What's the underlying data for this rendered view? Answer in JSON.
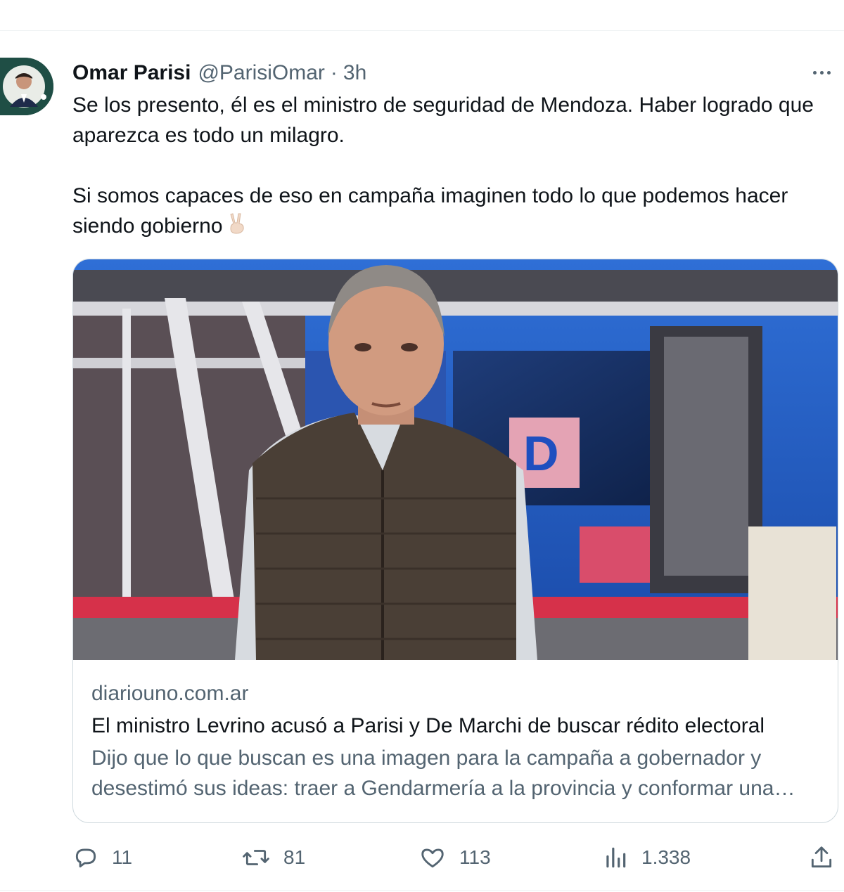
{
  "tweet": {
    "author_name": "Omar Parisi",
    "author_handle": "@ParisiOmar",
    "separator": "·",
    "time": "3h",
    "paragraph_1": "Se los presento, él es el ministro de seguridad de Mendoza. Haber logrado que aparezca es todo un milagro.",
    "paragraph_2": "Si somos capaces de eso en campaña imaginen todo lo que podemos hacer siendo gobierno",
    "emoji": "victory-hand-emoji"
  },
  "card": {
    "domain": "diariouno.com.ar",
    "title": "El ministro Levrino acusó a Parisi y De Marchi de buscar rédito electoral",
    "description": "Dijo que lo que buscan es una imagen para la campaña a gobernador y desestimó sus ideas: traer a Gendarmería a la provincia y conformar una policía",
    "image_icon": "news-photo-man-in-tv-studio"
  },
  "actions": {
    "replies": "11",
    "reposts": "81",
    "likes": "113",
    "views": "1.338"
  },
  "icons": {
    "reply": "reply-icon",
    "repost": "repost-icon",
    "like": "heart-icon",
    "views": "views-icon",
    "share": "share-icon",
    "more": "more-icon"
  },
  "colors": {
    "text_primary": "#0f1419",
    "text_secondary": "#536471",
    "border": "#cfd9de",
    "avatar_bg": "#1f4e45"
  }
}
